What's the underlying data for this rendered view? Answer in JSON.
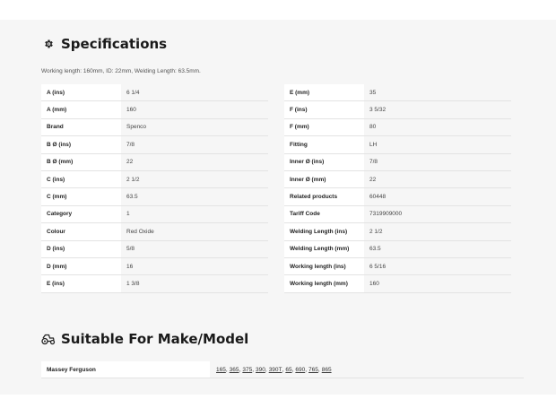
{
  "specifications": {
    "title": "Specifications",
    "icon": "gear-icon",
    "note": "Working length: 160mm, ID: 22mm, Welding Length: 63.5mm.",
    "left_rows": [
      {
        "label": "A (ins)",
        "value": "6 1/4"
      },
      {
        "label": "A (mm)",
        "value": "160"
      },
      {
        "label": "Brand",
        "value": "Spenco"
      },
      {
        "label": "B Ø (ins)",
        "value": "7/8"
      },
      {
        "label": "B Ø (mm)",
        "value": "22"
      },
      {
        "label": "C (ins)",
        "value": "2 1/2"
      },
      {
        "label": "C (mm)",
        "value": "63.5"
      },
      {
        "label": "Category",
        "value": "1"
      },
      {
        "label": "Colour",
        "value": "Red Oxide"
      },
      {
        "label": "D (ins)",
        "value": "5/8"
      },
      {
        "label": "D (mm)",
        "value": "16"
      },
      {
        "label": "E (ins)",
        "value": "1 3/8"
      }
    ],
    "right_rows": [
      {
        "label": "E (mm)",
        "value": "35"
      },
      {
        "label": "F (ins)",
        "value": "3 5/32"
      },
      {
        "label": "F (mm)",
        "value": "80"
      },
      {
        "label": "Fitting",
        "value": "LH"
      },
      {
        "label": "Inner Ø (ins)",
        "value": "7/8"
      },
      {
        "label": "Inner Ø (mm)",
        "value": "22"
      },
      {
        "label": "Related products",
        "value": "60448"
      },
      {
        "label": "Tariff Code",
        "value": "7319909000"
      },
      {
        "label": "Welding Length (ins)",
        "value": "2 1/2"
      },
      {
        "label": "Welding Length (mm)",
        "value": "63.5"
      },
      {
        "label": "Working length (ins)",
        "value": "6 5/16"
      },
      {
        "label": "Working length (mm)",
        "value": "160"
      }
    ]
  },
  "suitable": {
    "title": "Suitable For Make/Model",
    "icon": "tractor-icon",
    "make": "Massey Ferguson",
    "models": [
      "165",
      "365",
      "375",
      "390",
      "390T",
      "65",
      "690",
      "765",
      "865"
    ]
  }
}
